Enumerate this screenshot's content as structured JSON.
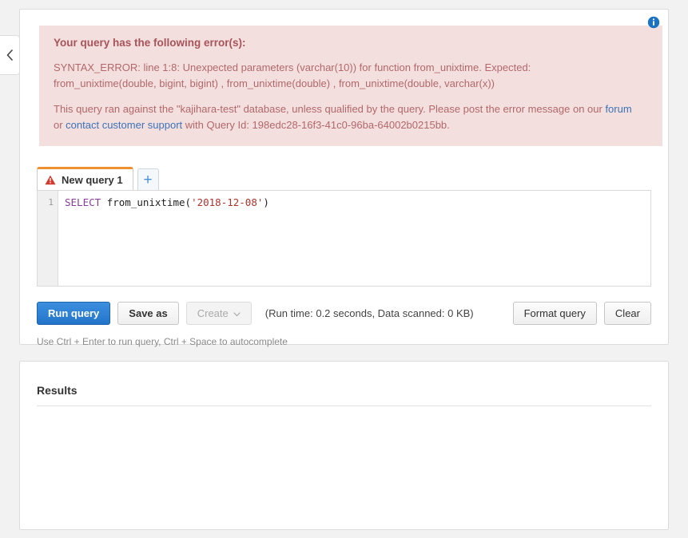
{
  "sidebar_toggle": {
    "icon": "chevron-left-icon",
    "label": "‹"
  },
  "info_icon": {
    "name": "info-icon",
    "glyph": "i"
  },
  "error_alert": {
    "title": "Your query has the following error(s):",
    "syntax_line_1": "SYNTAX_ERROR: line 1:8: Unexpected parameters (varchar(10)) for function from_unixtime. Expected:",
    "syntax_line_2": "from_unixtime(double, bigint, bigint) , from_unixtime(double) , from_unixtime(double, varchar(x))",
    "context_prefix": "This query ran against the \"kajihara-test\" database, unless qualified by the query. Please post the error message on our ",
    "forum_link": "forum",
    "context_or": "or ",
    "support_link": "contact customer support",
    "context_suffix": " with Query Id: 198edc28-16f3-41c0-96ba-64002b0215bb.",
    "query_id": "198edc28-16f3-41c0-96ba-64002b0215bb",
    "database": "kajihara-test",
    "bg_color": "#f4dfdf",
    "text_color": "#b2686a",
    "link_color": "#3c73b8"
  },
  "editor": {
    "tabs": [
      {
        "label": "New query 1",
        "icon": "warning-triangle-icon",
        "active": true,
        "accent_color": "#ec912d"
      }
    ],
    "add_tab_label": "+",
    "line_numbers": [
      "1"
    ],
    "code_tokens": [
      {
        "text": "SELECT",
        "type": "keyword"
      },
      {
        "text": " ",
        "type": "plain"
      },
      {
        "text": "from_unixtime",
        "type": "fn"
      },
      {
        "text": "(",
        "type": "punct"
      },
      {
        "text": "'2018-12-08'",
        "type": "string"
      },
      {
        "text": ")",
        "type": "punct"
      }
    ],
    "code_plain": "SELECT from_unixtime('2018-12-08')"
  },
  "actions": {
    "run_query": "Run query",
    "save_as": "Save as",
    "create": "Create",
    "create_caret": "˅",
    "run_stats": "(Run time: 0.2 seconds, Data scanned: 0 KB)",
    "format_query": "Format query",
    "clear": "Clear",
    "primary_color": "#2274c9"
  },
  "hint": "Use Ctrl + Enter to run query, Ctrl + Space to autocomplete",
  "results": {
    "title": "Results"
  }
}
